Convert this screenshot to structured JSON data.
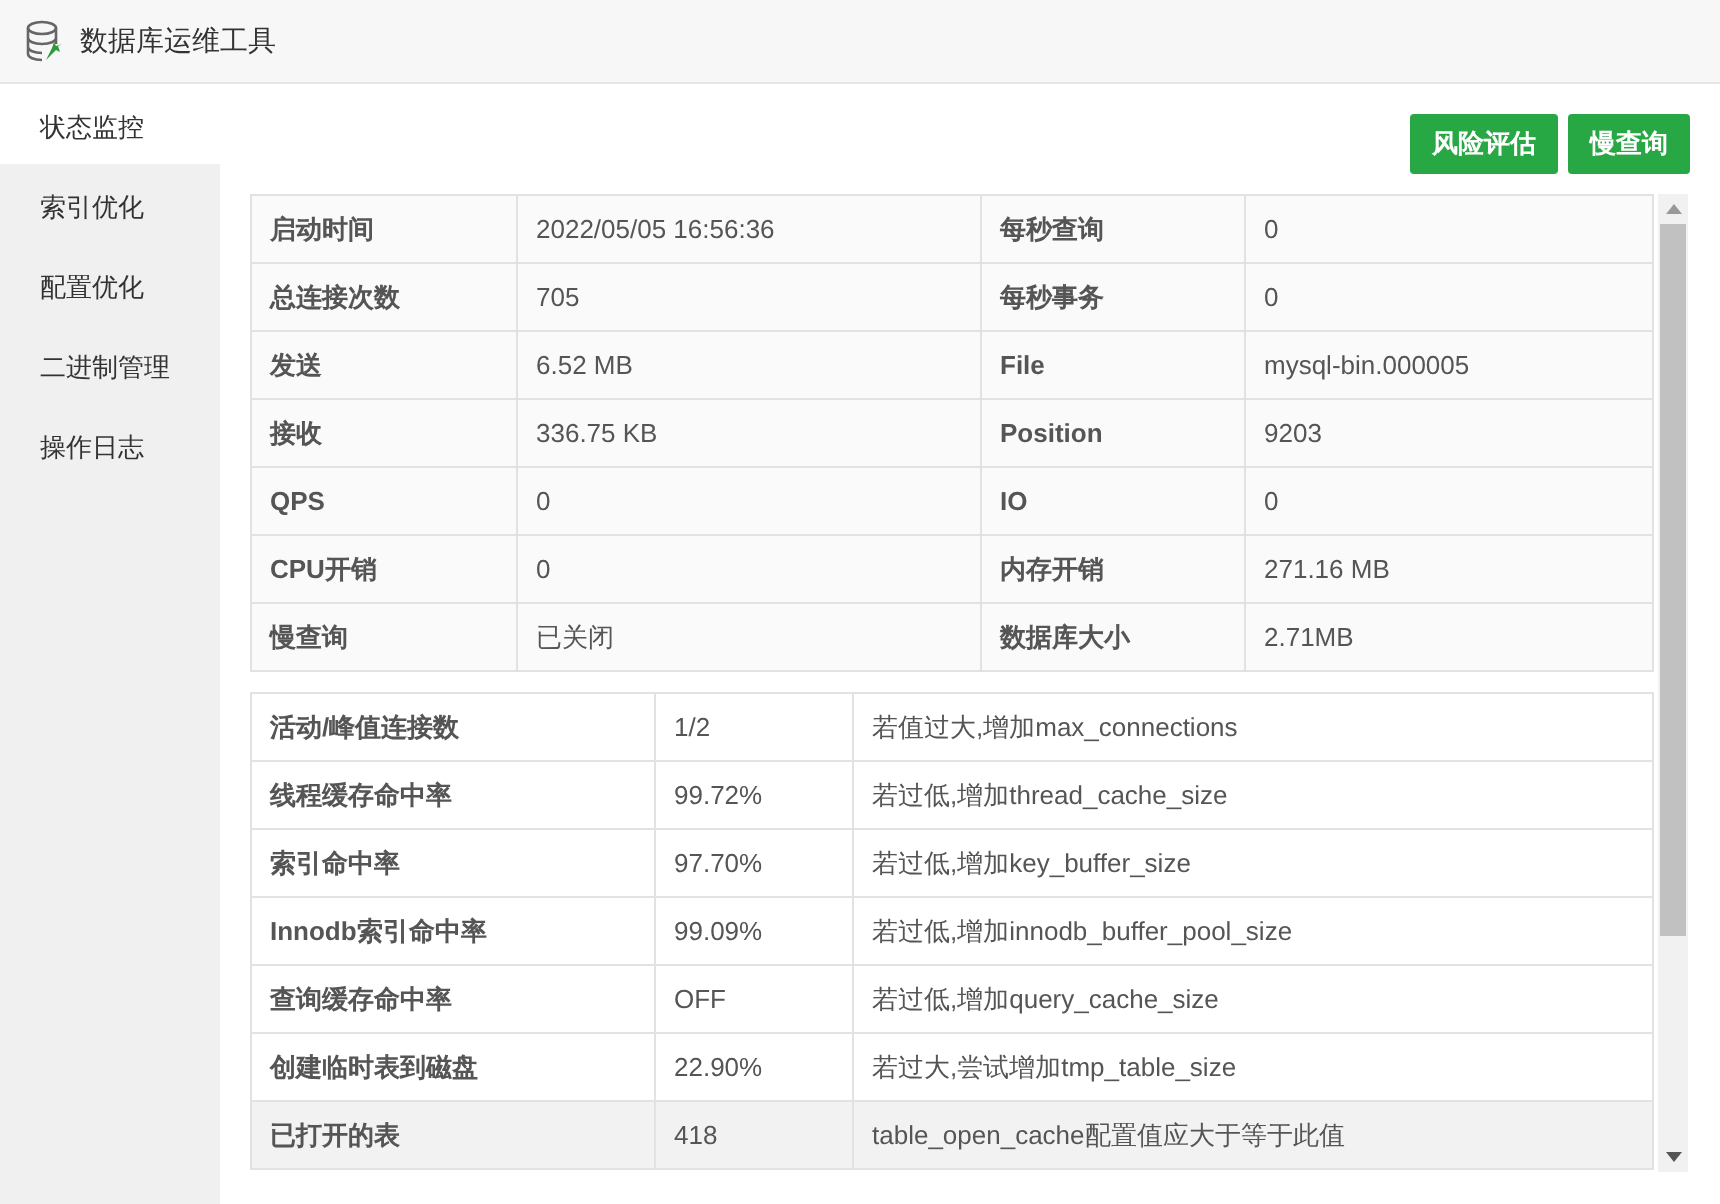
{
  "window": {
    "title": "数据库运维工具"
  },
  "sidebar": {
    "items": [
      {
        "label": "状态监控",
        "selected": true
      },
      {
        "label": "索引优化",
        "selected": false
      },
      {
        "label": "配置优化",
        "selected": false
      },
      {
        "label": "二进制管理",
        "selected": false
      },
      {
        "label": "操作日志",
        "selected": false
      }
    ]
  },
  "toolbar": {
    "buttons": [
      "风险评估",
      "慢查询"
    ]
  },
  "status_table": {
    "rows": [
      [
        "启动时间",
        "2022/05/05 16:56:36",
        "每秒查询",
        "0"
      ],
      [
        "总连接次数",
        "705",
        "每秒事务",
        "0"
      ],
      [
        "发送",
        "6.52 MB",
        "File",
        "mysql-bin.000005"
      ],
      [
        "接收",
        "336.75 KB",
        "Position",
        "9203"
      ],
      [
        "QPS",
        "0",
        "IO",
        "0"
      ],
      [
        "CPU开销",
        "0",
        "内存开销",
        "271.16 MB"
      ],
      [
        "慢查询",
        "已关闭",
        "数据库大小",
        "2.71MB"
      ]
    ]
  },
  "metrics_table": {
    "rows": [
      {
        "cells": [
          "活动/峰值连接数",
          "1/2",
          "若值过大,增加max_connections"
        ],
        "highlighted": false
      },
      {
        "cells": [
          "线程缓存命中率",
          "99.72%",
          "若过低,增加thread_cache_size"
        ],
        "highlighted": false
      },
      {
        "cells": [
          "索引命中率",
          "97.70%",
          "若过低,增加key_buffer_size"
        ],
        "highlighted": false
      },
      {
        "cells": [
          "Innodb索引命中率",
          "99.09%",
          "若过低,增加innodb_buffer_pool_size"
        ],
        "highlighted": false
      },
      {
        "cells": [
          "查询缓存命中率",
          "OFF",
          "若过低,增加query_cache_size"
        ],
        "highlighted": false
      },
      {
        "cells": [
          "创建临时表到磁盘",
          "22.90%",
          "若过大,尝试增加tmp_table_size"
        ],
        "highlighted": false
      },
      {
        "cells": [
          "已打开的表",
          "418",
          "table_open_cache配置值应大于等于此值"
        ],
        "highlighted": true
      }
    ]
  }
}
